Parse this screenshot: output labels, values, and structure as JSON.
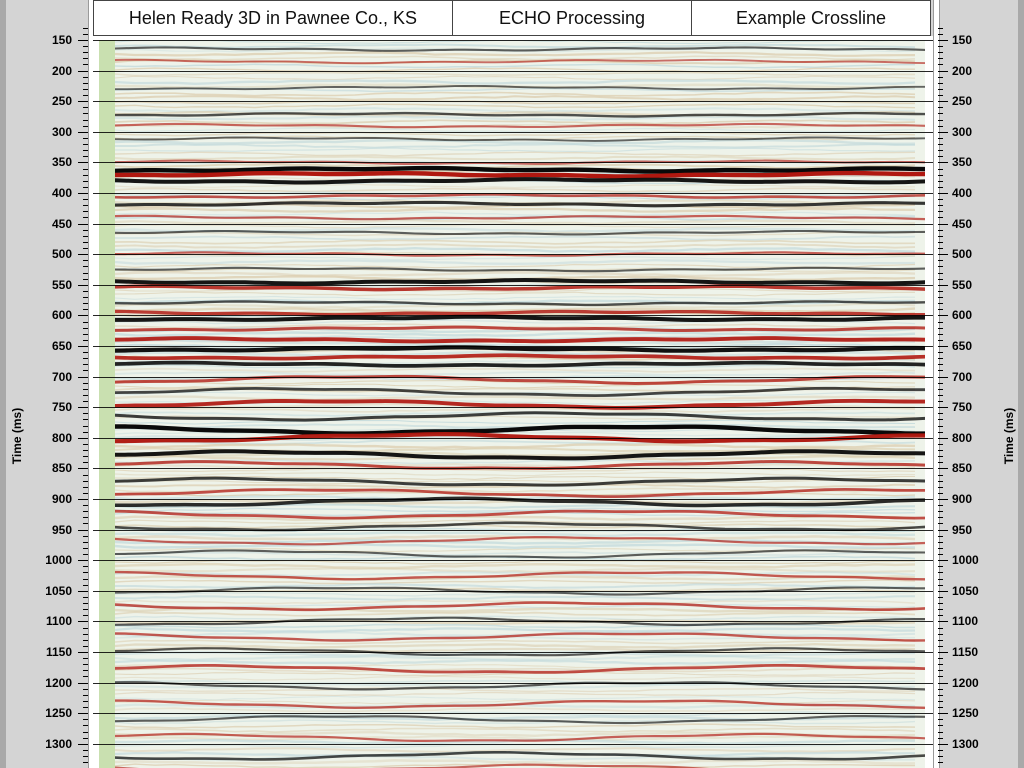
{
  "header": {
    "cells": [
      "Helen Ready 3D in Pawnee Co., KS",
      "ECHO Processing",
      "Example Crossline"
    ]
  },
  "colors": {
    "trough": "#0a0a0a",
    "peak": "#b01810",
    "background": "#eef3ea",
    "fill_low": "#c9e0b0",
    "midtone_blue": "#bcd6da",
    "midtone_tan": "#d9c9a8"
  },
  "chart_data": {
    "type": "heatmap",
    "title": "",
    "xlabel": "",
    "ylabel": "Time (ms)",
    "ylim": [
      128,
      1350
    ],
    "y_inverted": true,
    "y_ticks": [
      150,
      200,
      250,
      300,
      350,
      400,
      450,
      500,
      550,
      600,
      650,
      700,
      750,
      800,
      850,
      900,
      950,
      1000,
      1050,
      1100,
      1150,
      1200,
      1250,
      1300
    ],
    "grid": true,
    "reflectors": [
      {
        "time": 165,
        "polarity": "trough",
        "strength": 0.35
      },
      {
        "time": 185,
        "polarity": "peak",
        "strength": 0.3
      },
      {
        "time": 228,
        "polarity": "trough",
        "strength": 0.3
      },
      {
        "time": 272,
        "polarity": "trough",
        "strength": 0.45
      },
      {
        "time": 290,
        "polarity": "peak",
        "strength": 0.35
      },
      {
        "time": 312,
        "polarity": "trough",
        "strength": 0.3
      },
      {
        "time": 350,
        "polarity": "peak",
        "strength": 0.35
      },
      {
        "time": 362,
        "polarity": "trough",
        "strength": 1.0
      },
      {
        "time": 370,
        "polarity": "peak",
        "strength": 1.0
      },
      {
        "time": 380,
        "polarity": "trough",
        "strength": 0.9
      },
      {
        "time": 405,
        "polarity": "peak",
        "strength": 0.5
      },
      {
        "time": 418,
        "polarity": "trough",
        "strength": 0.65
      },
      {
        "time": 440,
        "polarity": "peak",
        "strength": 0.4
      },
      {
        "time": 465,
        "polarity": "trough",
        "strength": 0.35
      },
      {
        "time": 500,
        "polarity": "peak",
        "strength": 0.4
      },
      {
        "time": 525,
        "polarity": "trough",
        "strength": 0.35
      },
      {
        "time": 545,
        "polarity": "trough",
        "strength": 0.9
      },
      {
        "time": 555,
        "polarity": "peak",
        "strength": 0.75
      },
      {
        "time": 580,
        "polarity": "trough",
        "strength": 0.45
      },
      {
        "time": 596,
        "polarity": "peak",
        "strength": 0.7
      },
      {
        "time": 605,
        "polarity": "trough",
        "strength": 0.9
      },
      {
        "time": 622,
        "polarity": "peak",
        "strength": 0.6
      },
      {
        "time": 640,
        "polarity": "peak",
        "strength": 0.85
      },
      {
        "time": 655,
        "polarity": "trough",
        "strength": 0.95
      },
      {
        "time": 668,
        "polarity": "peak",
        "strength": 0.8
      },
      {
        "time": 680,
        "polarity": "trough",
        "strength": 0.8
      },
      {
        "time": 705,
        "polarity": "peak",
        "strength": 0.6
      },
      {
        "time": 725,
        "polarity": "trough",
        "strength": 0.55
      },
      {
        "time": 745,
        "polarity": "peak",
        "strength": 0.85
      },
      {
        "time": 765,
        "polarity": "trough",
        "strength": 0.6
      },
      {
        "time": 787,
        "polarity": "trough",
        "strength": 1.0
      },
      {
        "time": 800,
        "polarity": "peak",
        "strength": 0.95
      },
      {
        "time": 828,
        "polarity": "trough",
        "strength": 0.9
      },
      {
        "time": 845,
        "polarity": "peak",
        "strength": 0.6
      },
      {
        "time": 872,
        "polarity": "trough",
        "strength": 0.6
      },
      {
        "time": 890,
        "polarity": "peak",
        "strength": 0.55
      },
      {
        "time": 905,
        "polarity": "trough",
        "strength": 0.75
      },
      {
        "time": 925,
        "polarity": "peak",
        "strength": 0.55
      },
      {
        "time": 945,
        "polarity": "trough",
        "strength": 0.5
      },
      {
        "time": 968,
        "polarity": "peak",
        "strength": 0.4
      },
      {
        "time": 990,
        "polarity": "trough",
        "strength": 0.35
      },
      {
        "time": 1025,
        "polarity": "peak",
        "strength": 0.45
      },
      {
        "time": 1050,
        "polarity": "trough",
        "strength": 0.35
      },
      {
        "time": 1075,
        "polarity": "peak",
        "strength": 0.5
      },
      {
        "time": 1100,
        "polarity": "trough",
        "strength": 0.4
      },
      {
        "time": 1125,
        "polarity": "peak",
        "strength": 0.45
      },
      {
        "time": 1150,
        "polarity": "trough",
        "strength": 0.4
      },
      {
        "time": 1178,
        "polarity": "peak",
        "strength": 0.55
      },
      {
        "time": 1205,
        "polarity": "trough",
        "strength": 0.4
      },
      {
        "time": 1235,
        "polarity": "peak",
        "strength": 0.45
      },
      {
        "time": 1260,
        "polarity": "trough",
        "strength": 0.35
      },
      {
        "time": 1290,
        "polarity": "peak",
        "strength": 0.4
      },
      {
        "time": 1320,
        "polarity": "trough",
        "strength": 0.5
      },
      {
        "time": 1340,
        "polarity": "peak",
        "strength": 0.35
      }
    ]
  }
}
